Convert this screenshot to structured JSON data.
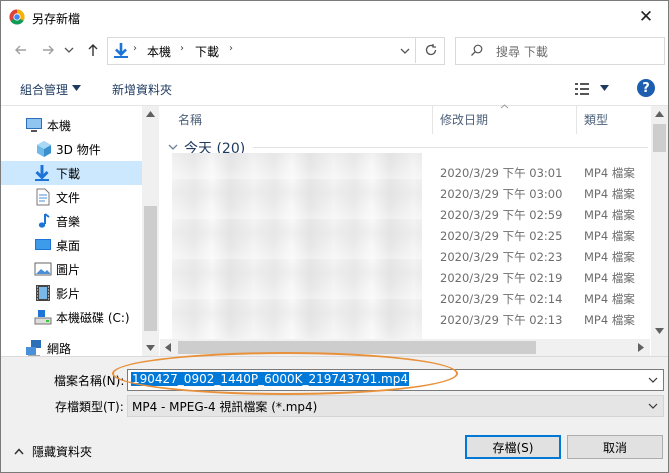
{
  "window": {
    "title": "另存新檔"
  },
  "nav": {
    "breadcrumb": [
      "本機",
      "下載"
    ],
    "search_placeholder": "搜尋 下載"
  },
  "toolbar": {
    "organize": "組合管理",
    "new_folder": "新增資料夾"
  },
  "sidebar": {
    "items": [
      {
        "label": "本機",
        "icon": "computer-icon"
      },
      {
        "label": "3D 物件",
        "icon": "cube-icon"
      },
      {
        "label": "下載",
        "icon": "download-icon"
      },
      {
        "label": "文件",
        "icon": "document-icon"
      },
      {
        "label": "音樂",
        "icon": "music-icon"
      },
      {
        "label": "桌面",
        "icon": "desktop-icon"
      },
      {
        "label": "圖片",
        "icon": "pictures-icon"
      },
      {
        "label": "影片",
        "icon": "video-icon"
      },
      {
        "label": "本機磁碟 (C:)",
        "icon": "drive-icon"
      },
      {
        "label": "網路",
        "icon": "network-icon"
      }
    ]
  },
  "list": {
    "columns": [
      "名稱",
      "修改日期",
      "類型"
    ],
    "group_label": "今天 (20)",
    "rows": [
      {
        "date": "2020/3/29 下午 03:01",
        "type": "MP4 檔案"
      },
      {
        "date": "2020/3/29 下午 03:00",
        "type": "MP4 檔案"
      },
      {
        "date": "2020/3/29 下午 02:59",
        "type": "MP4 檔案"
      },
      {
        "date": "2020/3/29 下午 02:25",
        "type": "MP4 檔案"
      },
      {
        "date": "2020/3/29 下午 02:23",
        "type": "MP4 檔案"
      },
      {
        "date": "2020/3/29 下午 02:19",
        "type": "MP4 檔案"
      },
      {
        "date": "2020/3/29 下午 02:14",
        "type": "MP4 檔案"
      },
      {
        "date": "2020/3/29 下午 02:13",
        "type": "MP4 檔案"
      }
    ]
  },
  "form": {
    "filename_label": "檔案名稱(N):",
    "filename_value": "190427_0902_1440P_6000K_219743791.mp4",
    "filetype_label": "存檔類型(T):",
    "filetype_value": "MP4 - MPEG-4 視訊檔案 (*.mp4)"
  },
  "footer": {
    "hide_folders": "隱藏資料夾",
    "save": "存檔(S)",
    "cancel": "取消"
  },
  "colors": {
    "accent": "#0078d7",
    "selection": "#cce8ff",
    "highlight_ring": "#e8913a"
  }
}
